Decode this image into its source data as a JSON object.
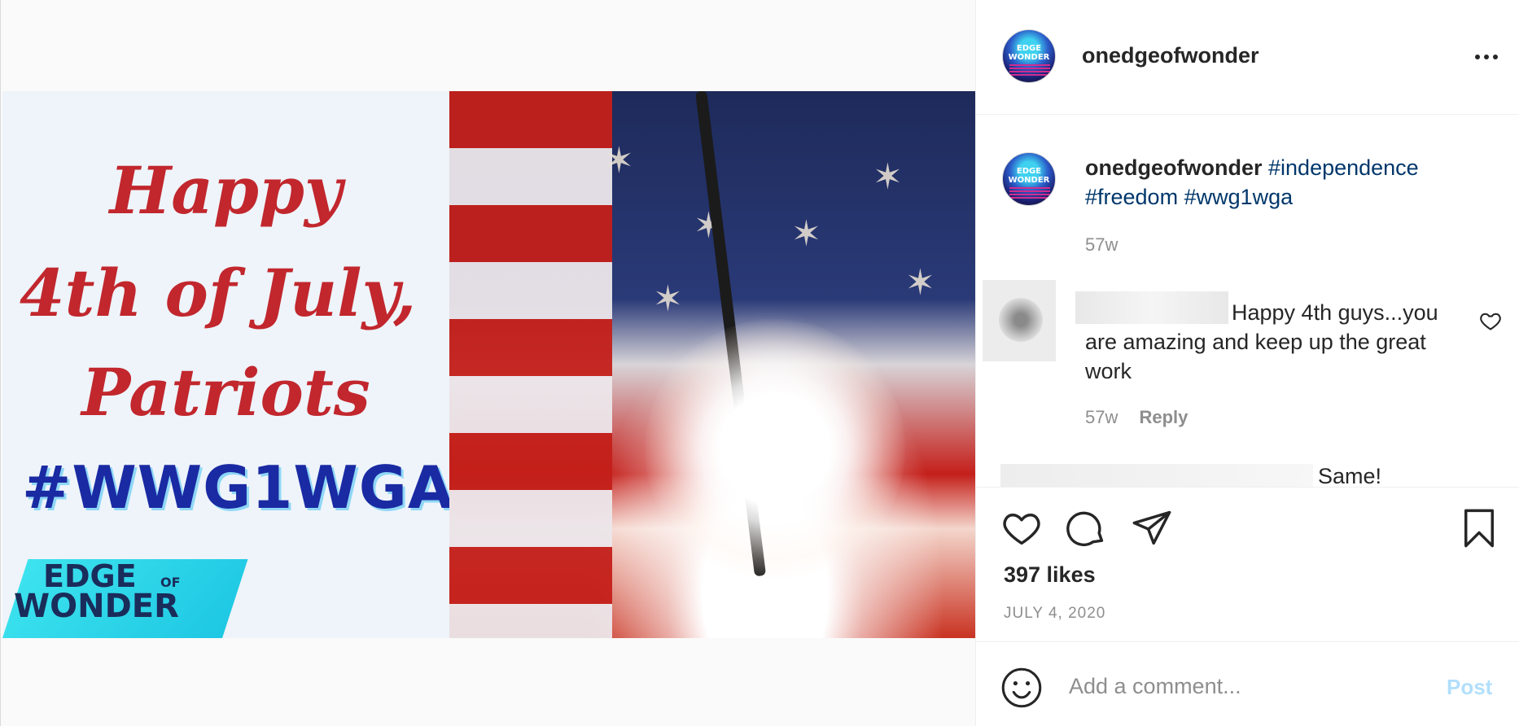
{
  "post_image": {
    "greeting_line1": "Happy",
    "greeting_line2": "4th of July,",
    "greeting_line3": "Patriots",
    "hashtag": "#WWG1WGA",
    "logo_line1": "EDGE",
    "logo_of": "OF",
    "logo_line2": "WONDER"
  },
  "header": {
    "avatar_line1": "EDGE",
    "avatar_line2": "WONDER",
    "username": "onedgeofwonder",
    "more_icon": "more-horizontal-icon"
  },
  "caption": {
    "username": "onedgeofwonder",
    "tags": [
      "#independence",
      "#freedom",
      "#wwg1wga"
    ],
    "time": "57w"
  },
  "comments": [
    {
      "text": "Happy 4th guys...you are amazing and keep up the great work",
      "time": "57w",
      "reply_label": "Reply"
    }
  ],
  "partial_comment": {
    "text": "Same!"
  },
  "actions": {
    "like_icon": "heart-icon",
    "comment_icon": "comment-icon",
    "share_icon": "paper-plane-icon",
    "save_icon": "bookmark-icon",
    "likes": "397 likes",
    "date": "JULY 4, 2020"
  },
  "add_comment": {
    "emoji_icon": "smiley-icon",
    "placeholder": "Add a comment...",
    "post_label": "Post"
  }
}
